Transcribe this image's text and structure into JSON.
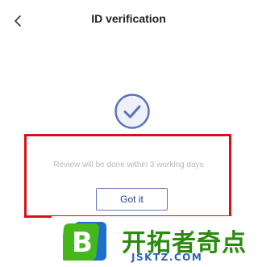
{
  "header": {
    "title": "ID verification",
    "back_icon": "chevron-left-icon"
  },
  "status": {
    "icon": "check-circle-icon",
    "message": "Review will be done within 3 working days"
  },
  "actions": {
    "got_it_label": "Got it"
  },
  "watermark": {
    "logo_letter": "B",
    "brand_text": "开拓者奇点",
    "domain": "JSKTZ.COM"
  },
  "colors": {
    "accent": "#2a3f86",
    "check_circle": "#5c73b8",
    "highlight_border": "#d7101b",
    "watermark_green": "#2c8a10",
    "watermark_blue": "#2a62b8"
  }
}
